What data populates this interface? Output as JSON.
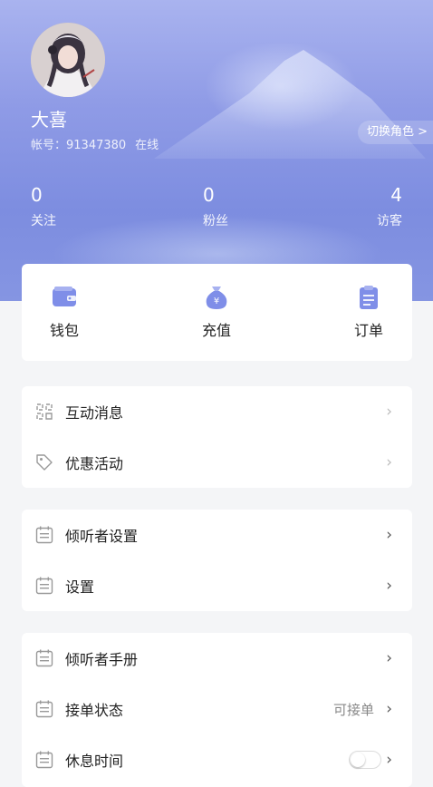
{
  "profile": {
    "name": "大喜",
    "account_label": "帐号：91347380",
    "status": "在线",
    "switch_role": "切换角色 >"
  },
  "stats": [
    {
      "value": "0",
      "label": "关注"
    },
    {
      "value": "0",
      "label": "粉丝"
    },
    {
      "value": "4",
      "label": "访客"
    }
  ],
  "quick_actions": [
    {
      "label": "钱包",
      "icon": "wallet-icon"
    },
    {
      "label": "充值",
      "icon": "money-bag-icon"
    },
    {
      "label": "订单",
      "icon": "clipboard-icon"
    }
  ],
  "menu_groups": [
    [
      {
        "label": "互动消息",
        "icon": "message-grid-icon"
      },
      {
        "label": "优惠活动",
        "icon": "tag-icon"
      }
    ],
    [
      {
        "label": "倾听者设置",
        "icon": "list-icon"
      },
      {
        "label": "设置",
        "icon": "list-icon"
      }
    ],
    [
      {
        "label": "倾听者手册",
        "icon": "list-icon"
      },
      {
        "label": "接单状态",
        "icon": "list-icon",
        "value": "可接单"
      },
      {
        "label": "休息时间",
        "icon": "list-icon",
        "toggle": false
      }
    ]
  ],
  "chevron": "›",
  "colors": {
    "accent": "#7f8ee8",
    "header_top": "#a9b3ef",
    "header_bottom": "#7d8de0"
  }
}
